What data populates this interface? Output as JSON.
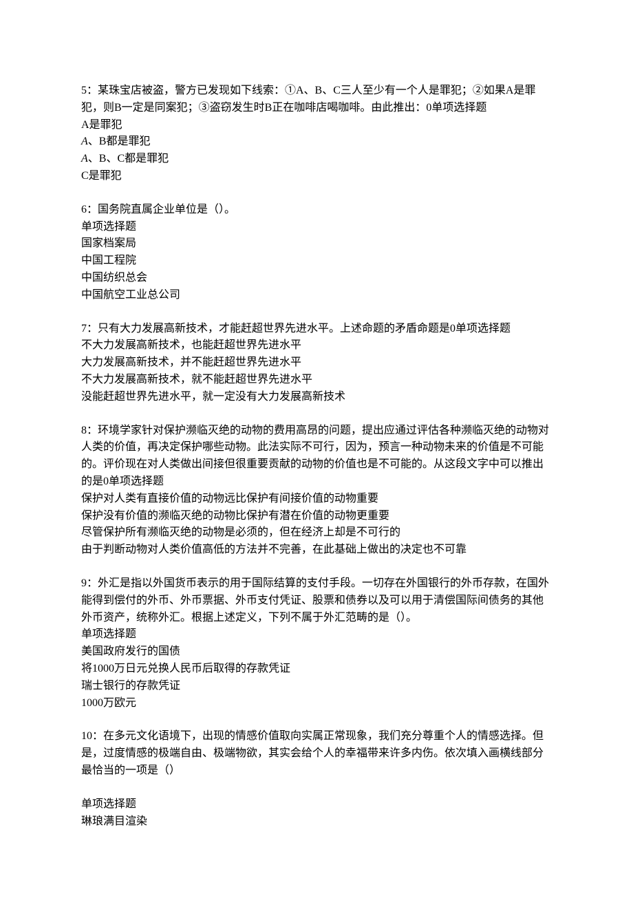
{
  "q5": {
    "stem": "5：某珠宝店被盗，警方已发现如下线索：①A、B、C三人至少有一个人是罪犯；②如果A是罪犯，则B一定是同案犯；③盗窃发生时B正在咖啡店喝咖啡。由此推出：0单项选择题",
    "options": [
      "A是罪犯",
      "、B都是罪犯",
      "、B、C都是罪犯",
      "C是罪犯"
    ]
  },
  "q6": {
    "stem": "6：国务院直属企业单位是（）。",
    "type": "单项选择题",
    "options": [
      "国家档案局",
      "中国工程院",
      "中国纺织总会",
      "中国航空工业总公司"
    ]
  },
  "q7": {
    "stem": "7：只有大力发展高新技术，才能赶超世界先进水平。上述命题的矛盾命题是0单项选择题",
    "options": [
      "不大力发展高新技术，也能赶超世界先进水平",
      "大力发展高新技术，并不能赶超世界先进水平",
      "不大力发展高新技术，就不能赶超世界先进水平",
      "没能赶超世界先进水平，就一定没有大力发展高新技术"
    ]
  },
  "q8": {
    "stem": "8：环境学家针对保护濒临灭绝的动物的费用高昂的问题，提出应通过评估各种濒临灭绝的动物对人类的价值，再决定保护哪些动物。此法实际不可行，因为，预言一种动物未来的价值是不可能的。评价现在对人类做出间接但很重要贡献的动物的价值也是不可能的。从这段文字中可以推出的是0单项选择题",
    "options": [
      "保护对人类有直接价值的动物远比保护有间接价值的动物重要",
      "保护没有价值的濒临灭绝的动物比保护有潜在价值的动物更重要",
      "尽管保护所有濒临灭绝的动物是必须的，但在经济上却是不可行的",
      "由于判断动物对人类价值高低的方法并不完善，在此基础上做出的决定也不可靠"
    ]
  },
  "q9": {
    "stem": "9：外汇是指以外国货币表示的用于国际结算的支付手段。一切存在外国银行的外币存款，在国外能得到偿付的外币、外币票据、外币支付凭证、股票和债券以及可以用于清偿国际间债务的其他外币资产，统称外汇。根据上述定义，下列不属于外汇范畴的是（）。",
    "type": "单项选择题",
    "options": [
      "美国政府发行的国债",
      "将1000万日元兑换人民币后取得的存款凭证",
      "瑞士银行的存款凭证",
      "1000万欧元"
    ]
  },
  "q10": {
    "stem": "10：在多元文化语境下，出现的情感价值取向实属正常现象，我们充分尊重个人的情感选择。但是，过度情感的极端自由、极端物欲，其实会给个人的幸福带来许多内伤。依次填入画横线部分最恰当的一项是（）",
    "type": "单项选择题",
    "options": [
      "琳琅满目渲染"
    ]
  },
  "italicA": "A"
}
